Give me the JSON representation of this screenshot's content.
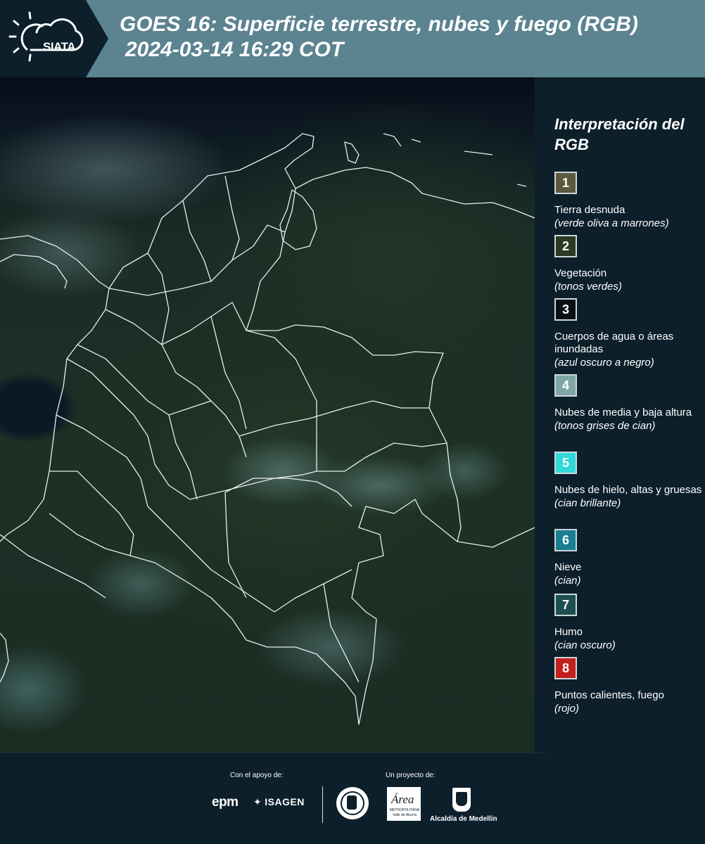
{
  "header": {
    "logo_text": "SIATA",
    "title_line1": "GOES 16: Superficie terrestre, nubes y fuego (RGB)",
    "title_line2": "2024-03-14 16:29 COT"
  },
  "legend": {
    "title": "Interpretación del RGB",
    "items": [
      {
        "number": "1",
        "label": "Tierra desnuda",
        "desc": "(verde oliva a marrones)",
        "color": "#5b5a3f"
      },
      {
        "number": "2",
        "label": "Vegetación",
        "desc": "(tonos verdes)",
        "color": "#2b3b22"
      },
      {
        "number": "3",
        "label": "Cuerpos de agua o áreas inundadas",
        "desc": "(azul oscuro a negro)",
        "color": "#0a0f16"
      },
      {
        "number": "4",
        "label": "Nubes de media y baja altura",
        "desc": "(tonos grises de cian)",
        "color": "#7fa6a6"
      },
      {
        "number": "5",
        "label": "Nubes de hielo, altas y gruesas",
        "desc": "(cian brillante)",
        "color": "#2fd9d8"
      },
      {
        "number": "6",
        "label": "Nieve",
        "desc": "(cian)",
        "color": "#1a7e92"
      },
      {
        "number": "7",
        "label": "Humo",
        "desc": "(cian oscuro)",
        "color": "#1d4f52"
      },
      {
        "number": "8",
        "label": "Puntos calientes, fuego",
        "desc": "(rojo)",
        "color": "#c31f1f"
      }
    ]
  },
  "footer": {
    "support_label": "Con el apoyo de:",
    "project_label": "Un proyecto de:",
    "epm": "epm",
    "isagen": "ISAGEN",
    "area_word": "Área",
    "area_sub": "METROPOLITANA Valle de Aburrá",
    "medellin": "Alcaldía de Medellín"
  }
}
